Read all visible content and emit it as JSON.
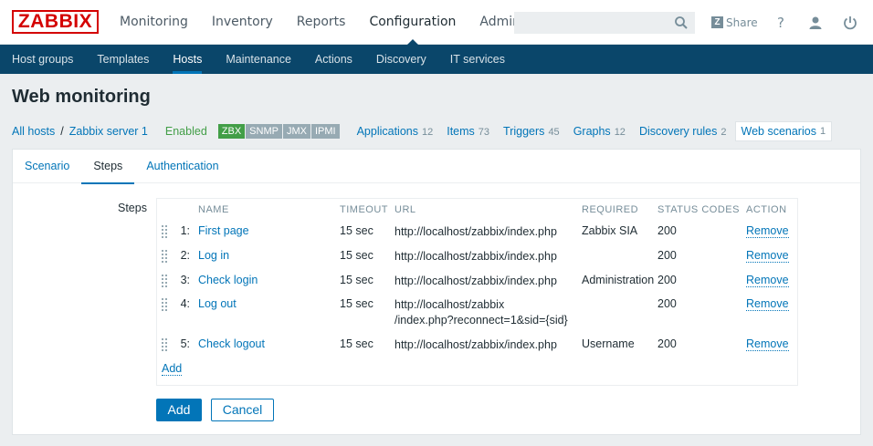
{
  "brand": {
    "logo_text": "ZABBIX",
    "color": "#d40000"
  },
  "main_nav": [
    {
      "label": "Monitoring"
    },
    {
      "label": "Inventory"
    },
    {
      "label": "Reports"
    },
    {
      "label": "Configuration",
      "active": true
    },
    {
      "label": "Administration"
    }
  ],
  "header": {
    "search_placeholder": "",
    "share_label": "Share",
    "share_badge": "Z",
    "help_icon": "question-mark-icon",
    "profile_icon": "user-icon",
    "logout_icon": "power-icon"
  },
  "sub_nav": [
    {
      "label": "Host groups"
    },
    {
      "label": "Templates"
    },
    {
      "label": "Hosts",
      "active": true
    },
    {
      "label": "Maintenance"
    },
    {
      "label": "Actions"
    },
    {
      "label": "Discovery"
    },
    {
      "label": "IT services"
    }
  ],
  "page_title": "Web monitoring",
  "host_nav": {
    "breadcrumb": {
      "all_hosts": "All hosts",
      "separator": "/",
      "host": "Zabbix server 1"
    },
    "status": "Enabled",
    "availability": [
      "ZBX",
      "SNMP",
      "JMX",
      "IPMI"
    ],
    "items": [
      {
        "label": "Applications",
        "count": "12"
      },
      {
        "label": "Items",
        "count": "73"
      },
      {
        "label": "Triggers",
        "count": "45"
      },
      {
        "label": "Graphs",
        "count": "12"
      },
      {
        "label": "Discovery rules",
        "count": "2"
      },
      {
        "label": "Web scenarios",
        "count": "1",
        "selected": true
      }
    ]
  },
  "tabs": [
    {
      "label": "Scenario"
    },
    {
      "label": "Steps",
      "active": true
    },
    {
      "label": "Authentication"
    }
  ],
  "steps": {
    "label": "Steps",
    "columns": [
      "NAME",
      "TIMEOUT",
      "URL",
      "REQUIRED",
      "STATUS CODES",
      "ACTION"
    ],
    "rows": [
      {
        "num": "1:",
        "name": "First page",
        "timeout": "15 sec",
        "url": "http://localhost/zabbix/index.php",
        "url2": "",
        "required": "Zabbix SIA",
        "codes": "200",
        "action": "Remove"
      },
      {
        "num": "2:",
        "name": "Log in",
        "timeout": "15 sec",
        "url": "http://localhost/zabbix/index.php",
        "url2": "",
        "required": "",
        "codes": "200",
        "action": "Remove"
      },
      {
        "num": "3:",
        "name": "Check login",
        "timeout": "15 sec",
        "url": "http://localhost/zabbix/index.php",
        "url2": "",
        "required": "Administration",
        "codes": "200",
        "action": "Remove"
      },
      {
        "num": "4:",
        "name": "Log out",
        "timeout": "15 sec",
        "url": "http://localhost/zabbix",
        "url2": "/index.php?reconnect=1&sid={sid}",
        "required": "",
        "codes": "200",
        "action": "Remove"
      },
      {
        "num": "5:",
        "name": "Check logout",
        "timeout": "15 sec",
        "url": "http://localhost/zabbix/index.php",
        "url2": "",
        "required": "Username",
        "codes": "200",
        "action": "Remove"
      }
    ],
    "add_link": "Add"
  },
  "buttons": {
    "add": "Add",
    "cancel": "Cancel"
  },
  "colors": {
    "primary": "#0275b8",
    "subnav_bg": "#0a466a",
    "enabled": "#429e47",
    "muted": "#768d99"
  }
}
